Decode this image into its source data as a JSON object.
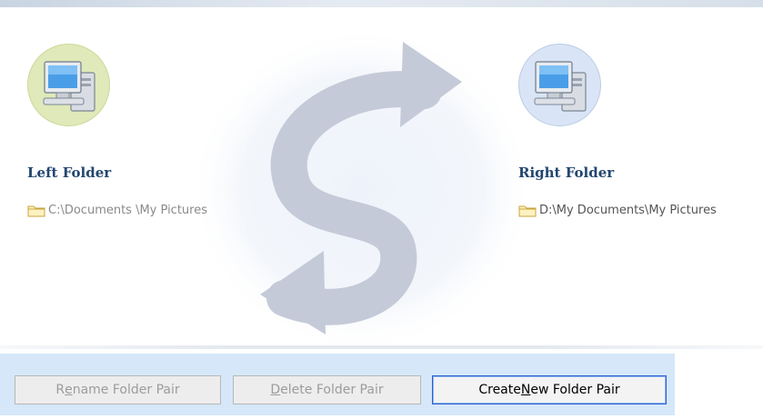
{
  "left_folder": {
    "title": "Left Folder",
    "path": "C:\\Documents \\My Pictures",
    "icon": "computer-icon",
    "folder_icon": "folder-icon"
  },
  "right_folder": {
    "title": "Right Folder",
    "path": "D:\\My Documents\\My Pictures",
    "icon": "computer-icon",
    "folder_icon": "folder-icon"
  },
  "watermark_icon": "sync-arrows-icon",
  "buttons": {
    "rename": {
      "before": "R",
      "mnemonic": "e",
      "after": "name Folder Pair",
      "enabled": false
    },
    "delete": {
      "before": "",
      "mnemonic": "D",
      "after": "elete Folder Pair",
      "enabled": false
    },
    "create": {
      "before": "Create ",
      "mnemonic": "N",
      "after": "ew Folder Pair",
      "enabled": true
    }
  },
  "colors": {
    "folder_title": "#23466f",
    "button_bar": "#d6e7f9",
    "focus_border": "#2a5fcf",
    "disabled_text": "#9c9c9c"
  }
}
